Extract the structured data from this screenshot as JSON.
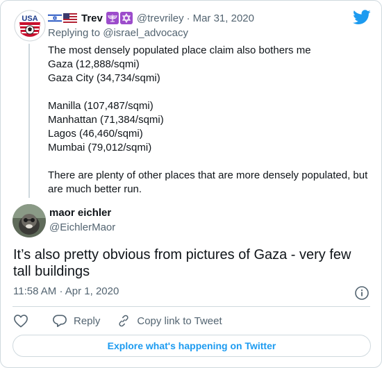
{
  "parent_tweet": {
    "name": "Trev",
    "handle": "@trevriley",
    "date_separator": "·",
    "date": "Mar 31, 2020",
    "replying_prefix": "Replying to",
    "replying_to": "@israel_advocacy",
    "avatar_text": "USA",
    "emoji_icons": [
      "menorah-icon"
    ],
    "flag_icons": [
      "israel-flag-icon",
      "us-flag-icon"
    ],
    "lines": [
      "The most densely populated place claim also bothers me",
      "Gaza (12,888/sqmi)",
      "Gaza City (34,734/sqmi)",
      "",
      "Manilla (107,487/sqmi)",
      "Manhattan (71,384/sqmi)",
      "Lagos (46,460/sqmi)",
      "Mumbai (79,012/sqmi)",
      "",
      "There are plenty of other places that are more densely populated, but are much better run."
    ]
  },
  "main_tweet": {
    "name": "maor eichler",
    "handle": "@EichlerMaor",
    "text": "It’s also pretty obvious from pictures of Gaza - very few tall buildings",
    "time": "11:58 AM",
    "date_separator": "·",
    "date": "Apr 1, 2020"
  },
  "actions": {
    "reply_label": "Reply",
    "copy_label": "Copy link to Tweet"
  },
  "explore_label": "Explore what's happening on Twitter",
  "colors": {
    "accent": "#1d9bf0",
    "text": "#0f1419",
    "muted": "#536471",
    "border": "#cfd9de"
  }
}
